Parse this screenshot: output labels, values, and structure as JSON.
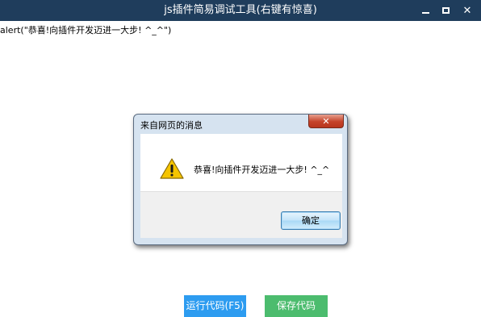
{
  "window": {
    "title": "js插件简易调试工具(右键有惊喜)",
    "minimize_icon": "minimize-icon",
    "maximize_icon": "maximize-icon",
    "close_icon": "close-icon",
    "titlebar_color": "#1f3d5c"
  },
  "editor": {
    "code": "alert(\"恭喜!向插件开发迈进一大步! ^_^\")"
  },
  "buttons": {
    "run_label": "运行代码(F5)",
    "save_label": "保存代码",
    "run_color": "#2d9cf0",
    "save_color": "#4cbc6e"
  },
  "dialog": {
    "title": "来自网页的消息",
    "message": "恭喜!向插件开发迈进一大步! ^_^",
    "icon": "warning-icon",
    "ok_label": "确定",
    "close_glyph": "✕"
  }
}
